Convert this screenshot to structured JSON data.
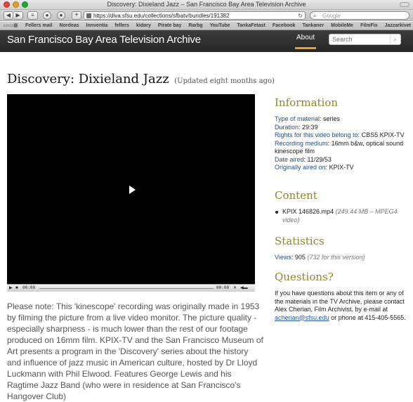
{
  "browser": {
    "window_title": "Discovery: Dixieland Jazz – San Francisco Bay Area Television Archive",
    "url": "https://diva.sfsu.edu/collections/sfbatv/bundles/191382",
    "search_placeholder": "Google",
    "bookmarks": [
      "Fellers mail",
      "Nordeas",
      "Innventia",
      "fellers",
      "kidory",
      "Pirate bay",
      "Rarbg",
      "YouTube",
      "TankaFetast",
      "Facebook",
      "Tankaner",
      "MobileMe",
      "FilmFix",
      "Jazzarkivet"
    ]
  },
  "site": {
    "title": "San Francisco Bay Area Television Archive",
    "about_label": "About",
    "search_placeholder": "Search",
    "accent_color": "#f29b2b"
  },
  "page": {
    "title": "Discovery: Dixieland Jazz",
    "updated": "(Updated eight months ago)"
  },
  "player": {
    "current_time": "00:00",
    "duration": "00:00"
  },
  "description": "Please note: This 'kinescope' recording was originally made in 1953 by filming the picture from a live video monitor. The picture quality - especially sharpness - is much lower than the rest of our footage produced on 16mm film. KPIX-TV and the San Francisco Museum of Art presents a program in the 'Discovery' series about the history and influence of jazz music in American culture, hosted by Dr Lloyd Luckmann with Phil Elwood. Features George Lewis and his Ragtime Jazz Band (who were in residence at San Francisco's Hangover Club)",
  "information": {
    "heading": "Information",
    "type_label": "Type of material",
    "type_value": "series",
    "duration_label": "Duration",
    "duration_value": "29:39",
    "rights_label": "Rights for this video belong to",
    "rights_value": "CBS5 KPIX-TV",
    "medium_label": "Recording medium",
    "medium_value": "16mm b&w, optical sound kinescope film",
    "date_label": "Date aired",
    "date_value": "11/29/53",
    "aired_label": "Originally aired on",
    "aired_value": "KPIX-TV"
  },
  "content": {
    "heading": "Content",
    "file_name": "KPIX 146826.mp4",
    "file_meta": "(249.44 MB – MPEG4 video)"
  },
  "statistics": {
    "heading": "Statistics",
    "views_label": "Views",
    "views_value": "905",
    "views_version": "(732 for this version)"
  },
  "questions": {
    "heading": "Questions?",
    "text_before": "If you have questions about this item or any of the materials in the TV Archive, please contact Alex Cherian, Film Archivist, by e-mail at ",
    "email": "acherian@sfsu.edu",
    "text_after": " or phone at 415-405-5565."
  }
}
